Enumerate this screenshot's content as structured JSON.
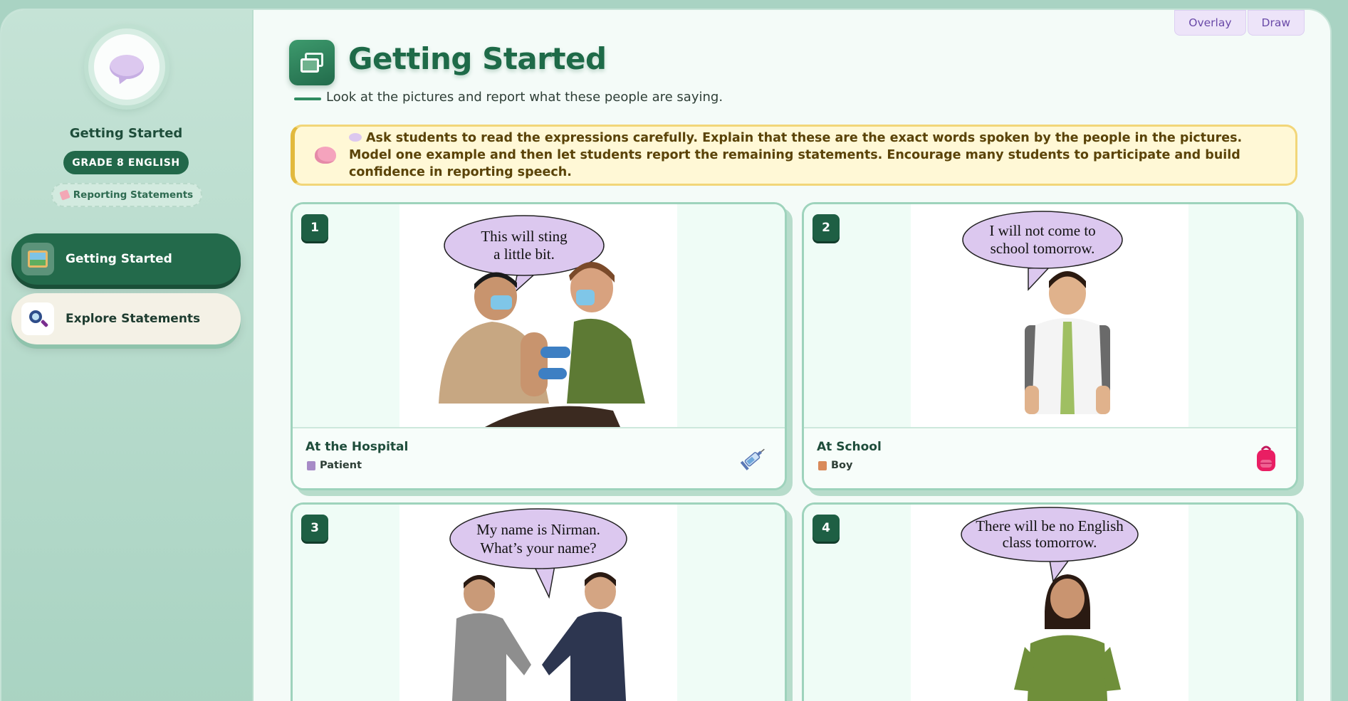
{
  "toolbar": {
    "overlay_label": "Overlay",
    "draw_label": "Draw"
  },
  "sidebar": {
    "title": "Getting Started",
    "grade": "GRADE 8 ENGLISH",
    "topic": "Reporting Statements",
    "nav": [
      {
        "label": "Getting Started",
        "active": true,
        "icon": "picture-icon"
      },
      {
        "label": "Explore Statements",
        "active": false,
        "icon": "magnifier-icon"
      }
    ]
  },
  "main": {
    "title": "Getting Started",
    "subtitle": "Look at the pictures and report what these people are saying.",
    "teacher_note": "Ask students to read the expressions carefully. Explain that these are the exact words spoken by the people in the pictures. Model one example and then let students report the remaining statements. Encourage many students to participate and build confidence in reporting speech.",
    "cards": [
      {
        "number": "1",
        "bubble": [
          "This will sting",
          "a little bit."
        ],
        "place": "At the Hospital",
        "speaker": "Patient",
        "icon": "syringe-icon"
      },
      {
        "number": "2",
        "bubble": [
          "I will not come to",
          "school tomorrow."
        ],
        "place": "At School",
        "speaker": "Boy",
        "icon": "backpack-icon"
      },
      {
        "number": "3",
        "bubble": [
          "My name is Nirman.",
          "What’s your name?"
        ]
      },
      {
        "number": "4",
        "bubble": [
          "There will be no English",
          "class tomorrow."
        ]
      }
    ]
  },
  "colors": {
    "accent": "#236a4b",
    "note_bg": "#fff8d6",
    "bubble": "#dcc8ef"
  }
}
